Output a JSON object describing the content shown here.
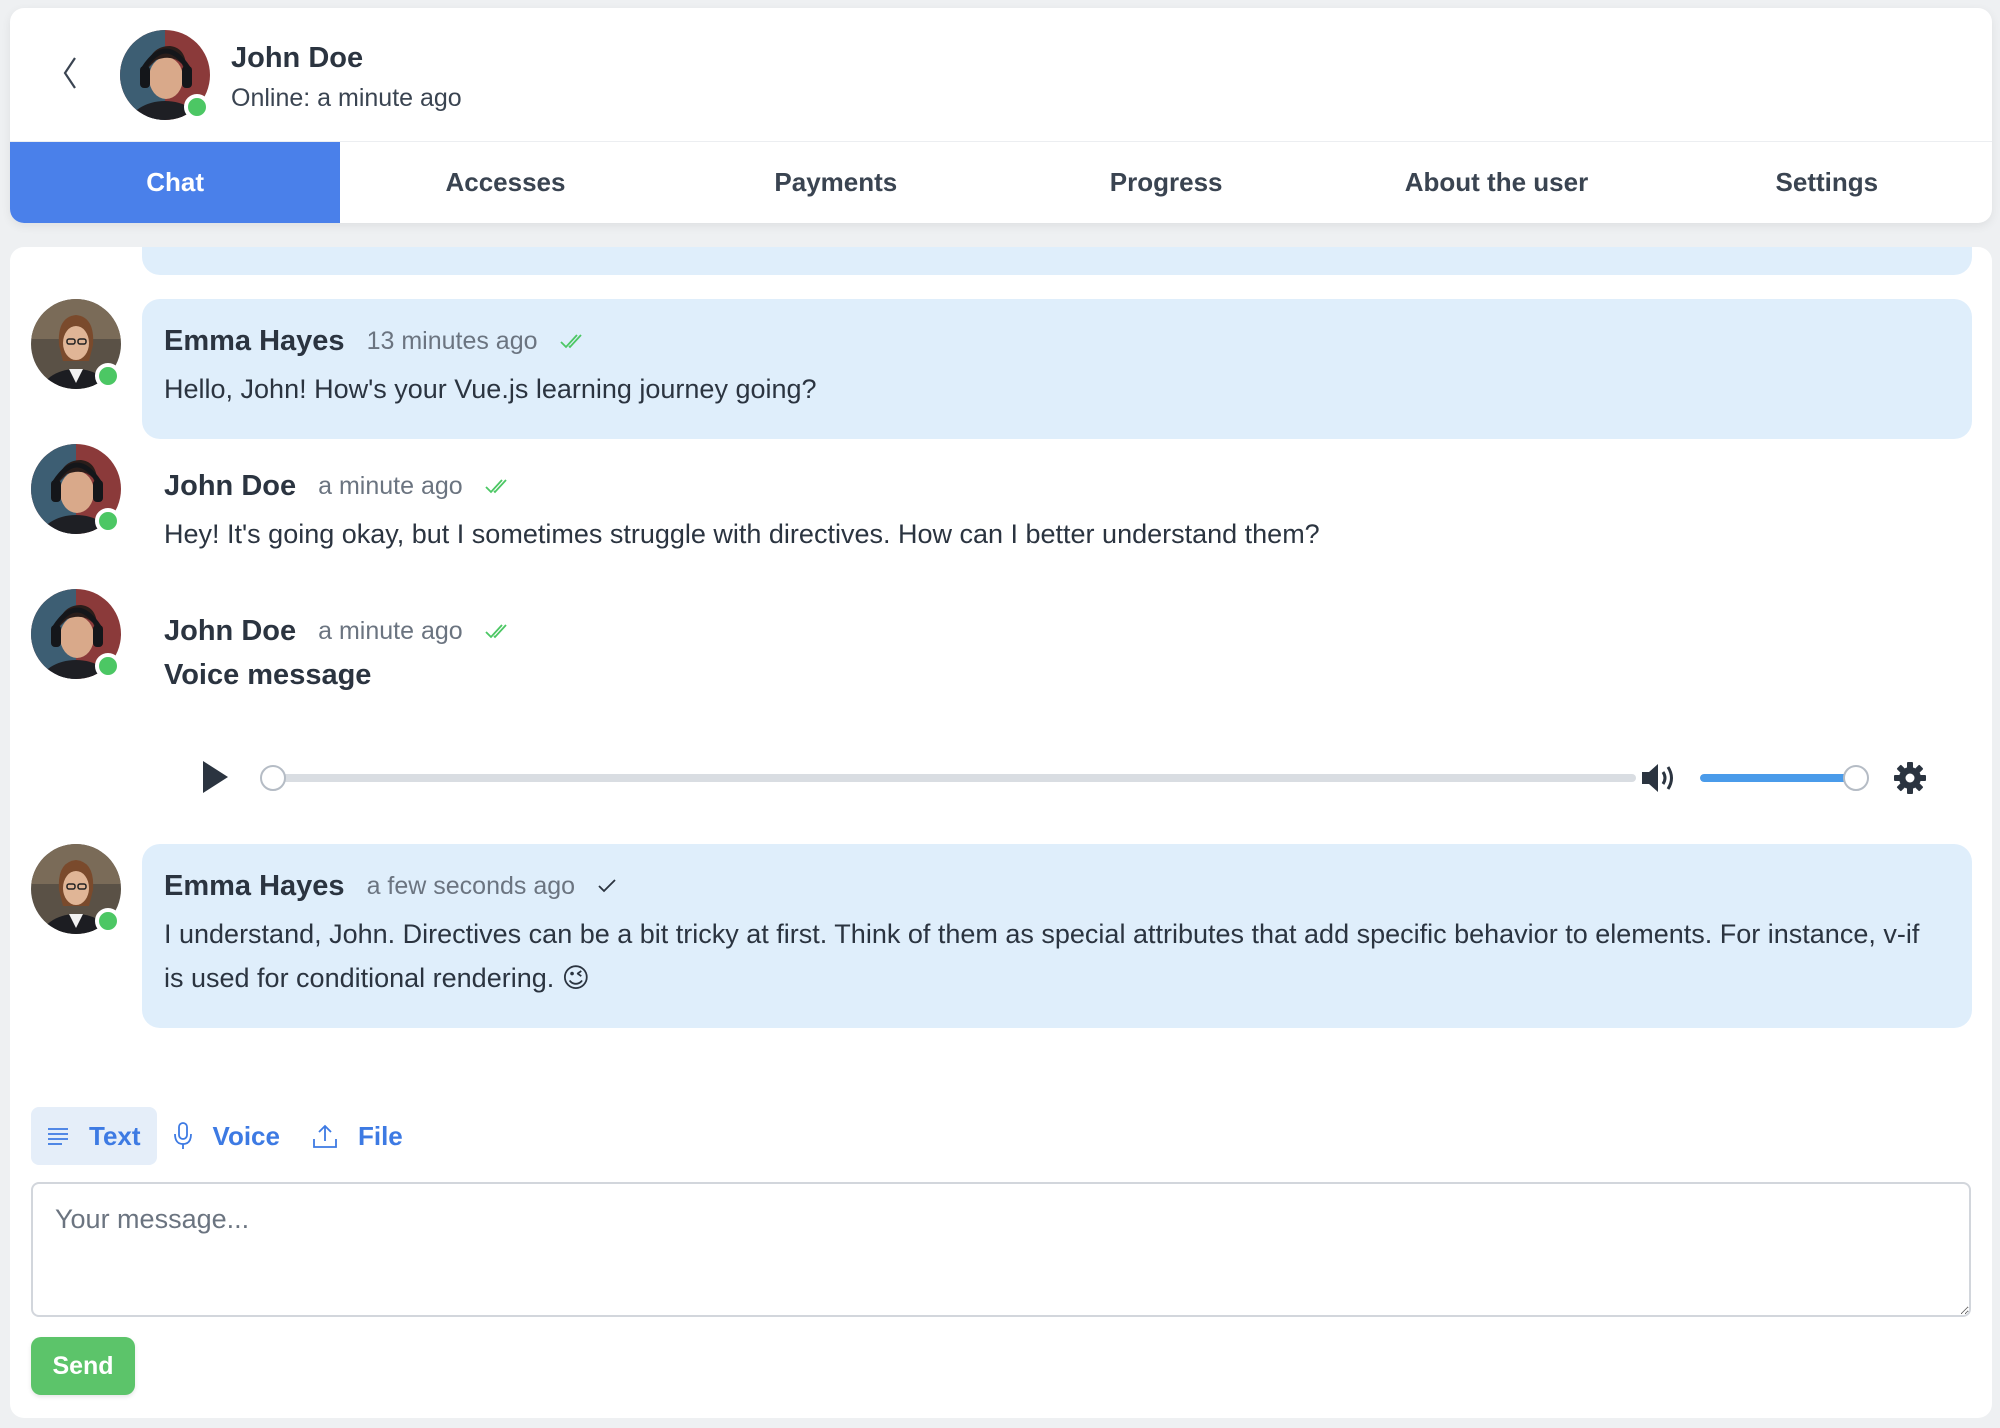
{
  "header": {
    "name": "John Doe",
    "status": "Online: a minute ago",
    "back_icon": "chevron-left-icon"
  },
  "tabs": [
    {
      "label": "Chat",
      "active": true
    },
    {
      "label": "Accesses",
      "active": false
    },
    {
      "label": "Payments",
      "active": false
    },
    {
      "label": "Progress",
      "active": false
    },
    {
      "label": "About the user",
      "active": false
    },
    {
      "label": "Settings",
      "active": false
    }
  ],
  "messages": [
    {
      "author": "Emma Hayes",
      "time": "13 minutes ago",
      "status": "read",
      "text": "Hello, John! How's your Vue.js learning journey going?"
    },
    {
      "author": "John Doe",
      "time": "a minute ago",
      "status": "read",
      "text": "Hey! It's going okay, but I sometimes struggle with directives. How can I better understand them?"
    },
    {
      "author": "John Doe",
      "time": "a minute ago",
      "status": "read",
      "text": "Voice message",
      "voice": {
        "progress": 0.0,
        "volume": 1.0
      }
    },
    {
      "author": "Emma Hayes",
      "time": "a few seconds ago",
      "status": "sent",
      "text": "I understand, John. Directives can be a bit tricky at first. Think of them as special attributes that add specific behavior to elements. For instance, v-if is used for conditional rendering. 😉"
    }
  ],
  "composer": {
    "modes": [
      {
        "label": "Text",
        "icon": "text-lines-icon",
        "active": true
      },
      {
        "label": "Voice",
        "icon": "microphone-icon",
        "active": false
      },
      {
        "label": "File",
        "icon": "upload-icon",
        "active": false
      }
    ],
    "placeholder": "Your message...",
    "send_label": "Send"
  },
  "colors": {
    "accent": "#4a80ea",
    "bubble": "#dfeefb",
    "online": "#4cc764",
    "send": "#5cc46a",
    "read_check": "#4cc764"
  }
}
